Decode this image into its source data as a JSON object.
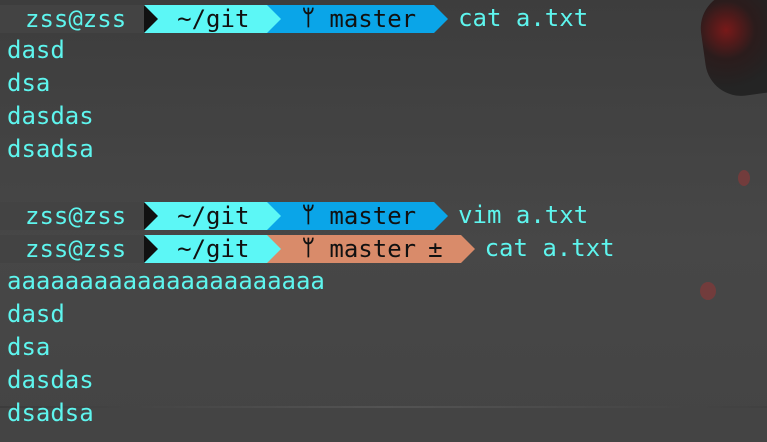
{
  "terminal": {
    "blocks": [
      {
        "prompt": {
          "user_host": "zss@zss",
          "dir": "~/git",
          "branch": "master",
          "dirty_marker": "",
          "command": "cat a.txt"
        },
        "output": [
          "dasd",
          "dsa",
          "dasdas",
          "dsadsa"
        ]
      },
      {
        "prompt": {
          "user_host": "zss@zss",
          "dir": "~/git",
          "branch": "master",
          "dirty_marker": "",
          "command": "vim a.txt"
        },
        "output": []
      },
      {
        "prompt": {
          "user_host": "zss@zss",
          "dir": "~/git",
          "branch": "master",
          "dirty_marker": "±",
          "command": "cat a.txt"
        },
        "output": [
          "aaaaaaaaaaaaaaaaaaaaaa",
          "dasd",
          "dsa",
          "dasdas",
          "dsadsa"
        ]
      }
    ],
    "icons": {
      "branch": "git-branch-icon"
    },
    "colors": {
      "text": "#5ef5ee",
      "dir_bg": "#5cf7f6",
      "git_clean_bg": "#0aa5e8",
      "git_dirty_bg": "#d98b6a",
      "bg": "#434343"
    }
  }
}
